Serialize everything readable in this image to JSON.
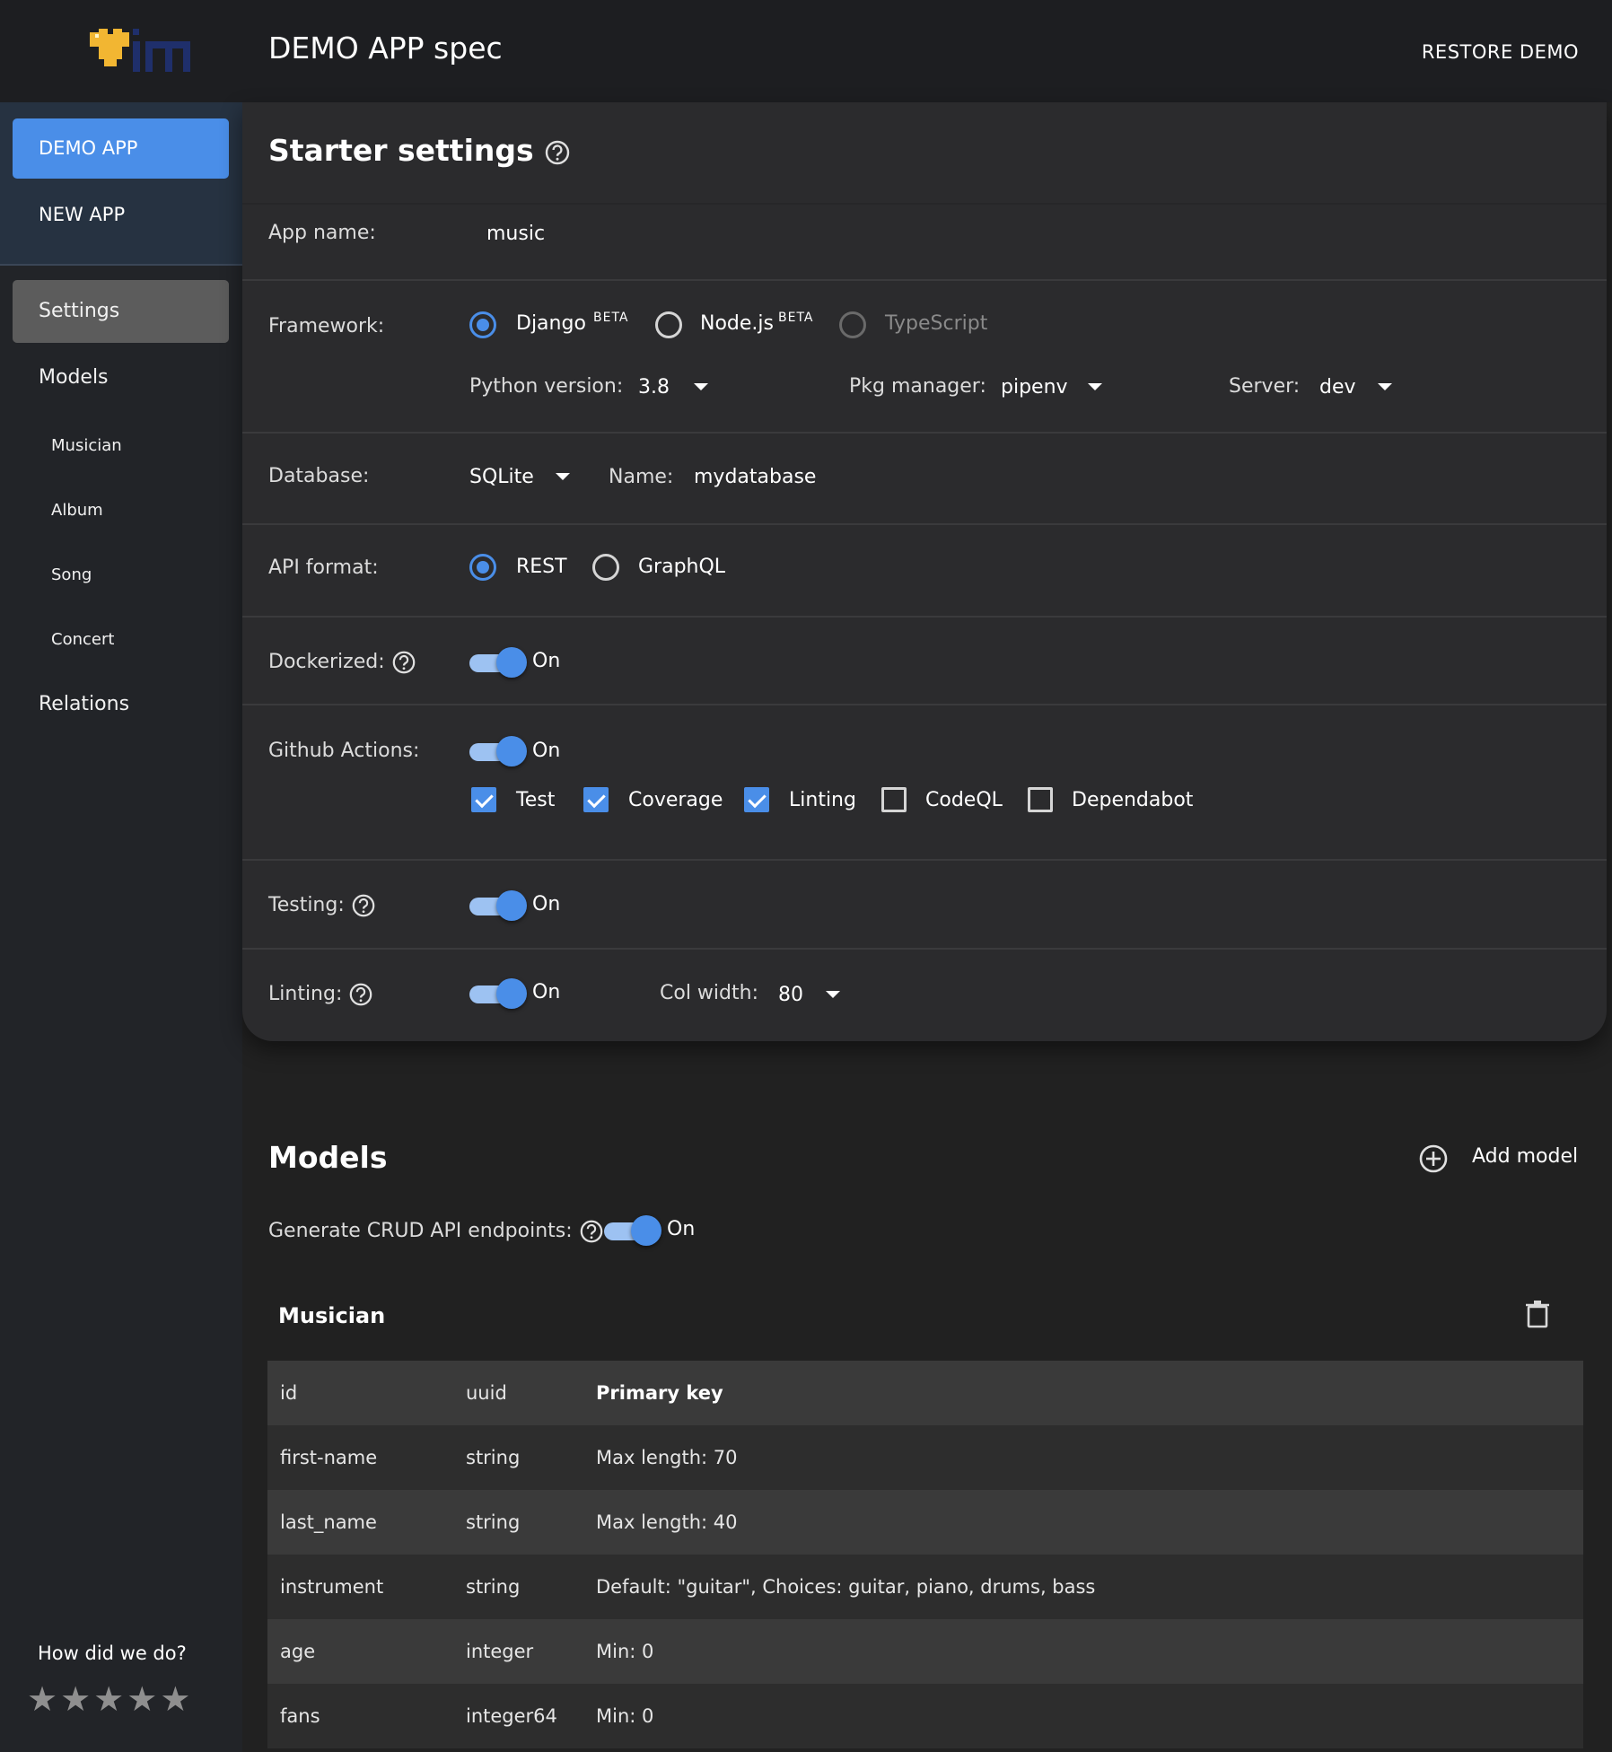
{
  "header": {
    "title": "DEMO APP spec",
    "restore_label": "RESTORE DEMO"
  },
  "sidebar": {
    "apps": [
      {
        "label": "DEMO APP",
        "active": true
      },
      {
        "label": "NEW APP",
        "active": false
      }
    ],
    "nav": {
      "settings": "Settings",
      "models": "Models",
      "model_items": [
        "Musician",
        "Album",
        "Song",
        "Concert"
      ],
      "relations": "Relations"
    },
    "rating_label": "How did we do?"
  },
  "starter": {
    "title": "Starter settings",
    "app_name_label": "App name:",
    "app_name_value": "music",
    "framework_label": "Framework:",
    "frameworks": [
      "Django",
      "Node.js",
      "TypeScript"
    ],
    "selected_framework": "Django",
    "beta_badge": "BETA",
    "python_version_label": "Python version:",
    "python_version": "3.8",
    "pkg_manager_label": "Pkg manager:",
    "pkg_manager": "pipenv",
    "server_label": "Server:",
    "server": "dev",
    "database_label": "Database:",
    "database": "SQLite",
    "db_name_label": "Name:",
    "db_name": "mydatabase",
    "api_format_label": "API format:",
    "api_formats": [
      "REST",
      "GraphQL"
    ],
    "selected_api_format": "REST",
    "dockerized_label": "Dockerized:",
    "dockerized_state": "On",
    "github_actions_label": "Github Actions:",
    "github_actions_state": "On",
    "github_checks": [
      {
        "label": "Test",
        "checked": true
      },
      {
        "label": "Coverage",
        "checked": true
      },
      {
        "label": "Linting",
        "checked": true
      },
      {
        "label": "CodeQL",
        "checked": false
      },
      {
        "label": "Dependabot",
        "checked": false
      }
    ],
    "testing_label": "Testing:",
    "testing_state": "On",
    "linting_label": "Linting:",
    "linting_state": "On",
    "col_width_label": "Col width:",
    "col_width": "80"
  },
  "models": {
    "title": "Models",
    "add_model_label": "Add model",
    "crud_label": "Generate CRUD API endpoints:",
    "crud_state": "On",
    "model_name": "Musician",
    "fields": [
      {
        "name": "id",
        "type": "uuid",
        "attr": "Primary key"
      },
      {
        "name": "first-name",
        "type": "string",
        "attr": "Max length: 70"
      },
      {
        "name": "last_name",
        "type": "string",
        "attr": "Max length: 40"
      },
      {
        "name": "instrument",
        "type": "string",
        "attr": "Default: \"guitar\", Choices: guitar, piano, drums, bass"
      },
      {
        "name": "age",
        "type": "integer",
        "attr": "Min: 0"
      },
      {
        "name": "fans",
        "type": "integer64",
        "attr": "Min: 0"
      }
    ]
  },
  "colors": {
    "accent": "#4a8ee8",
    "background": "#212121",
    "card": "#2b2b2d",
    "logo_heart": "#f2b632",
    "logo_text": "#1f2f6b"
  }
}
